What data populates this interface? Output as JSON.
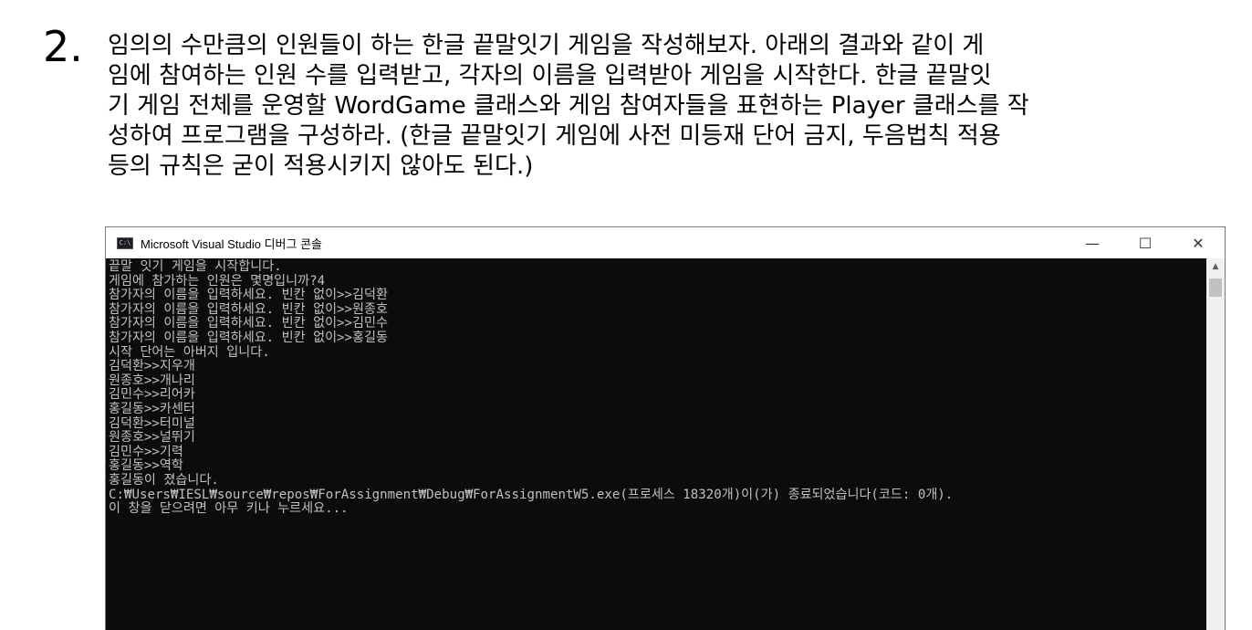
{
  "question": {
    "number": "2.",
    "lines": [
      "임의의 수만큼의 인원들이 하는 한글 끝말잇기 게임을 작성해보자. 아래의 결과와 같이 게",
      "임에 참여하는 인원 수를 입력받고, 각자의 이름을 입력받아 게임을 시작한다. 한글 끝말잇",
      "기 게임 전체를 운영할 WordGame 클래스와 게임 참여자들을 표현하는 Player 클래스를 작",
      "성하여 프로그램을 구성하라. (한글 끝말잇기 게임에 사전 미등재 단어 금지, 두음법칙 적용",
      "등의 규칙은 굳이 적용시키지 않아도 된다.)"
    ]
  },
  "window": {
    "icon_text": "C:\\",
    "title": "Microsoft Visual Studio 디버그 콘솔",
    "minimize": "—",
    "maximize": "☐",
    "close": "✕"
  },
  "console": {
    "lines": [
      "끝말 잇기 게임을 시작합니다.",
      "게임에 참가하는 인원은 몇명입니까?4",
      "참가자의 이름을 입력하세요. 빈칸 없이>>김덕환",
      "참가자의 이름을 입력하세요. 빈칸 없이>>원종호",
      "참가자의 이름을 입력하세요. 빈칸 없이>>김민수",
      "참가자의 이름을 입력하세요. 빈칸 없이>>홍길동",
      "시작 단어는 아버지 입니다.",
      "김덕환>>지우개",
      "원종호>>개나리",
      "김민수>>리어카",
      "홍길동>>카센터",
      "김덕환>>터미널",
      "원종호>>널뛰기",
      "김민수>>기력",
      "홍길동>>역학",
      "홍길동이 졌습니다.",
      "C:₩Users₩IESL₩source₩repos₩ForAssignment₩Debug₩ForAssignmentW5.exe(프로세스 18320개)이(가) 종료되었습니다(코드: 0개).",
      "이 창을 닫으려면 아무 키나 누르세요..."
    ]
  },
  "scrollbar": {
    "up_arrow": "▲"
  }
}
